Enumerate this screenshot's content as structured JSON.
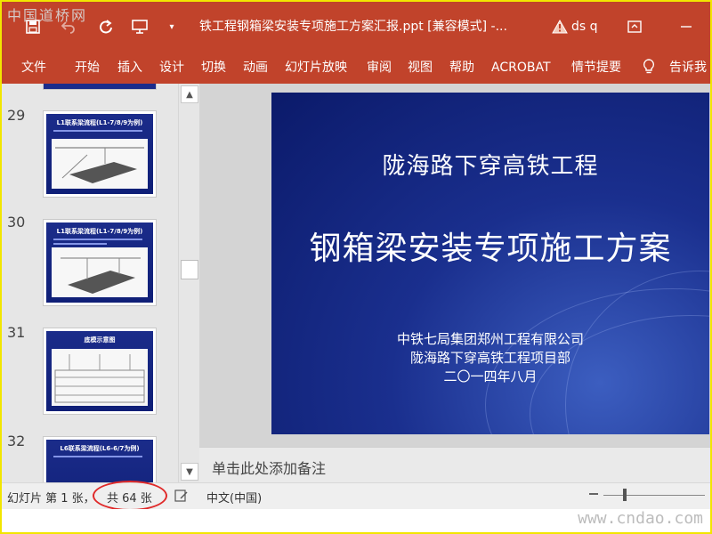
{
  "title_bar": {
    "watermark": "中国道桥网",
    "document_title": "铁工程钢箱梁安装专项施工方案汇报.ppt [兼容模式] -...",
    "warning_user": "ds q"
  },
  "ribbon_tabs": [
    "文件",
    "开始",
    "插入",
    "设计",
    "切换",
    "动画",
    "幻灯片放映",
    "审阅",
    "视图",
    "帮助",
    "ACROBAT",
    "情节提要",
    "告诉我"
  ],
  "thumbnails": [
    {
      "number": "29",
      "title": "L1联系梁流程(L1-7/8/9为例)"
    },
    {
      "number": "30",
      "title": "L1联系梁流程(L1-7/8/9为例)"
    },
    {
      "number": "31",
      "title": "底模示意图"
    },
    {
      "number": "32",
      "title": "L6联系梁流程(L6-6/7为例)"
    }
  ],
  "slide": {
    "title": "陇海路下穿高铁工程",
    "main_title": "钢箱梁安装专项施工方案",
    "org_line1": "中铁七局集团郑州工程有限公司",
    "org_line2": "陇海路下穿高铁工程项目部",
    "date": "二〇一四年八月"
  },
  "notes_placeholder": "单击此处添加备注",
  "status_bar": {
    "slide_label": "幻灯片 第 1 张，",
    "total_label": "共 64 张",
    "language": "中文(中国)"
  },
  "footer": {
    "watermark": "www.cndao.com"
  }
}
